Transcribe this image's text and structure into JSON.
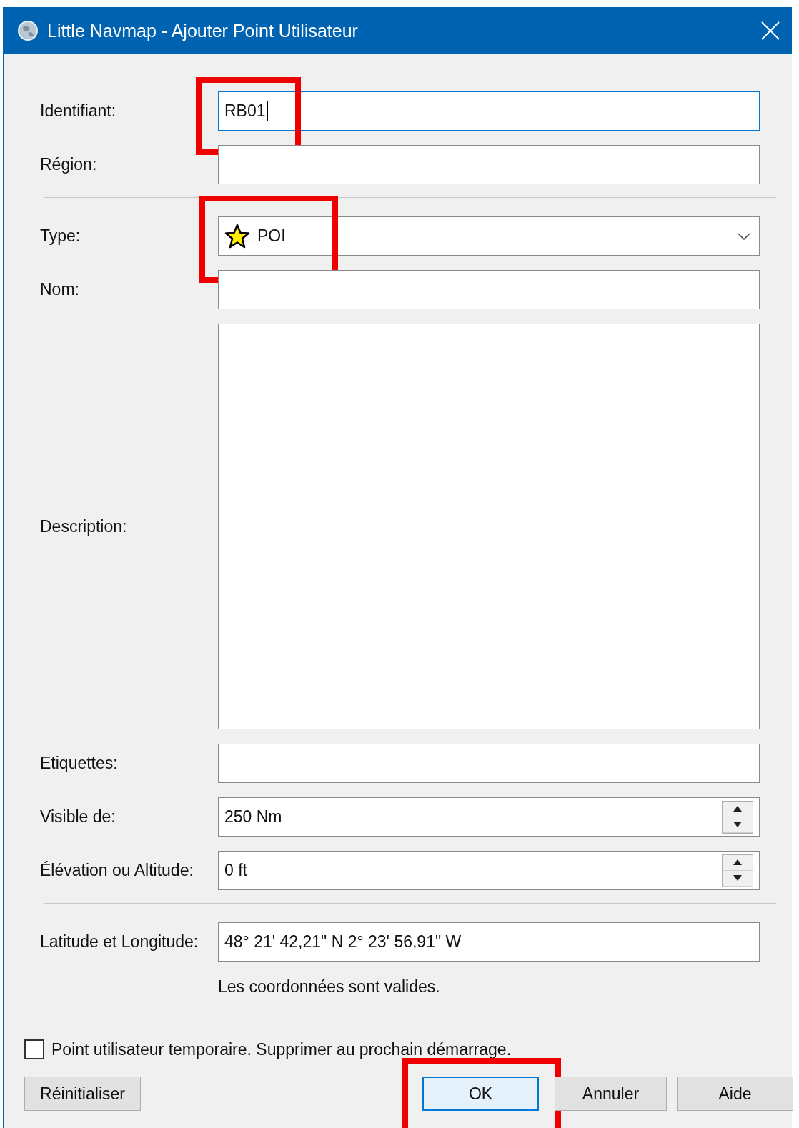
{
  "window": {
    "title": "Little Navmap - Ajouter Point Utilisateur"
  },
  "sections": [
    {
      "fields": [
        {
          "kind": "text",
          "label": "Identifiant:",
          "value": "RB01",
          "focused": true,
          "highlighted": true
        },
        {
          "kind": "text",
          "label": "Région:"
        }
      ]
    },
    {
      "fields": [
        {
          "kind": "combo",
          "label": "Type:",
          "value": "POI",
          "highlighted": true
        },
        {
          "kind": "text",
          "label": "Nom:"
        },
        {
          "kind": "textarea",
          "label": "Description:"
        },
        {
          "kind": "text",
          "label": "Etiquettes:"
        },
        {
          "kind": "spin",
          "label": "Visible de:",
          "value": "250 Nm"
        },
        {
          "kind": "spin",
          "label": "Élévation ou Altitude:",
          "value": "0 ft"
        }
      ]
    },
    {
      "fields": [
        {
          "kind": "text",
          "label": "Latitude et Longitude:",
          "value": "48° 21' 42,21\" N 2° 23' 56,91\" W",
          "note": "Les coordonnées sont valides."
        }
      ]
    }
  ],
  "checkbox": {
    "label": "Point utilisateur temporaire. Supprimer au prochain démarrage.",
    "checked": false
  },
  "buttons": [
    {
      "label": "Réinitialiser",
      "default": false,
      "highlighted": false
    },
    {
      "label": "OK",
      "default": true,
      "highlighted": true
    },
    {
      "label": "Annuler",
      "default": false,
      "highlighted": false
    },
    {
      "label": "Aide",
      "default": false,
      "highlighted": false
    }
  ]
}
